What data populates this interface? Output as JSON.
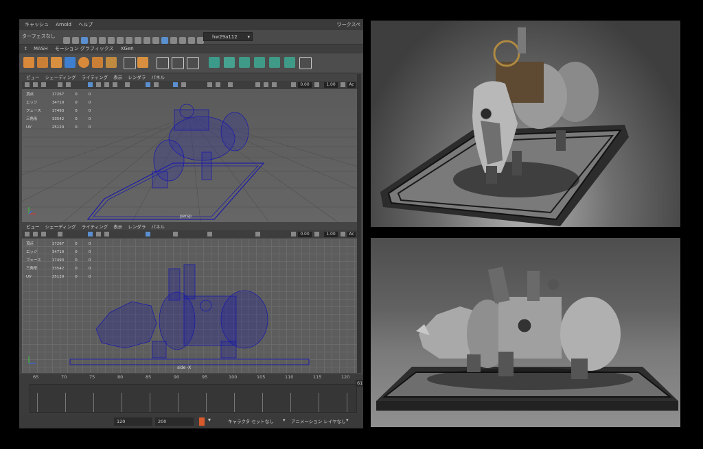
{
  "maya": {
    "menu": [
      "キャッシュ",
      "Arnold",
      "ヘルプ"
    ],
    "workspace_label": "ワークスペ",
    "status_prefix": "ターフェスなし",
    "scene_field": "hw29a112",
    "shelf_tabs": [
      "t",
      "MASH",
      "モーション グラフィックス",
      "XGen"
    ],
    "viewport_menu": [
      "ビュー",
      "シェーディング",
      "ライティング",
      "表示",
      "レンダラ",
      "パネル"
    ],
    "toolbar_values": {
      "exposure": "0.00",
      "gamma": "1.00",
      "extra": "Ac"
    },
    "stats": [
      {
        "label": "頂点",
        "v1": "17267",
        "v2": "0",
        "v3": "0"
      },
      {
        "label": "エッジ",
        "v1": "34710",
        "v2": "0",
        "v3": "0"
      },
      {
        "label": "フェース",
        "v1": "17493",
        "v2": "0",
        "v3": "0"
      },
      {
        "label": "三角形",
        "v1": "33542",
        "v2": "0",
        "v3": "0"
      },
      {
        "label": "UV",
        "v1": "25120",
        "v2": "0",
        "v3": "0"
      }
    ],
    "top_camera": "persp",
    "bottom_camera": "side -X",
    "timeline_ticks": [
      "65",
      "70",
      "75",
      "80",
      "85",
      "90",
      "95",
      "100",
      "105",
      "110",
      "115",
      "120"
    ],
    "current_frame": "61",
    "range_start": "120",
    "range_end": "200",
    "character_set": "キャラクタ セットなし",
    "anim_layer": "アニメーション レイヤなし"
  },
  "colors": {
    "wire": "#1c1ca8",
    "accent": "#5a8fd0"
  }
}
